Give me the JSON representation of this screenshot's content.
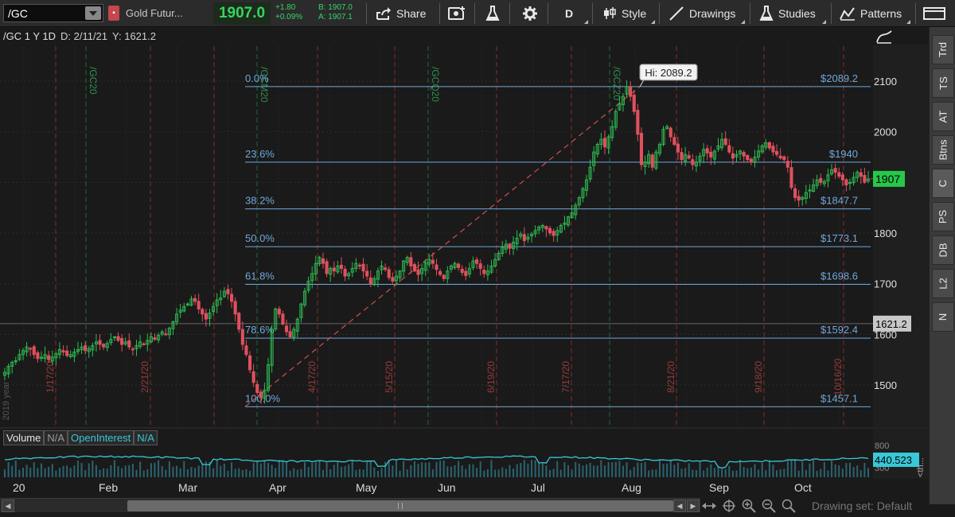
{
  "toolbar": {
    "symbol": "/GC",
    "description": "Gold Futur...",
    "last_price": "1907.0",
    "change": "+1.80",
    "change_pct": "+0.09%",
    "bid": "B: 1907.0",
    "ask": "A: 1907.1",
    "share_label": "Share",
    "period_label": "D",
    "style_label": "Style",
    "drawings_label": "Drawings",
    "studies_label": "Studies",
    "patterns_label": "Patterns",
    "icons": [
      "dropdown-icon",
      "share-icon",
      "screenshot-icon",
      "flask-icon",
      "gear-icon",
      "style-icon",
      "drawings-icon",
      "studies-icon",
      "patterns-icon",
      "layout-icon"
    ]
  },
  "chart_header": {
    "title": "/GC 1 Y 1D",
    "date": "D: 2/11/21",
    "yvalue": "Y: 1621.2"
  },
  "right_tabs": [
    "Trd",
    "TS",
    "AT",
    "Btns",
    "C",
    "PS",
    "DB",
    "L2",
    "N"
  ],
  "price_axis": {
    "ticks": [
      "2100",
      "2000",
      "1900",
      "1800",
      "1700",
      "1600",
      "1500"
    ],
    "current_label": "1907",
    "cursor_label": "1621.2"
  },
  "fib_levels": [
    {
      "pct": "0.0%",
      "price": "$2089.2",
      "value": 2089.2
    },
    {
      "pct": "23.6%",
      "price": "$1940",
      "value": 1940
    },
    {
      "pct": "38.2%",
      "price": "$1847.7",
      "value": 1847.7
    },
    {
      "pct": "50.0%",
      "price": "$1773.1",
      "value": 1773.1
    },
    {
      "pct": "61.8%",
      "price": "$1698.6",
      "value": 1698.6
    },
    {
      "pct": "78.6%",
      "price": "$1592.4",
      "value": 1592.4
    },
    {
      "pct": "100.0%",
      "price": "$1457.1",
      "value": 1457.1
    }
  ],
  "hi_label": "Hi: 2089.2",
  "contract_labels": [
    "/GC20",
    "/GCM20",
    "/GCQ20",
    "/GCZ20"
  ],
  "date_labels": [
    "1/17/20",
    "2/21/20",
    "4/17/20",
    "5/15/20",
    "6/19/20",
    "7/17/20",
    "8/21/20",
    "9/18/20",
    "10/16/20"
  ],
  "year_label": "2019 year",
  "volume_pane": {
    "volume_label": "Volume",
    "volume_value": "N/A",
    "oi_label": "OpenInterest",
    "oi_value": "N/A",
    "axis_top": "800",
    "axis_bottom": "300",
    "oi_current": "440.523",
    "side_label": "<th..."
  },
  "months": [
    "20",
    "Feb",
    "Mar",
    "Apr",
    "May",
    "Jun",
    "Jul",
    "Aug",
    "Sep",
    "Oct"
  ],
  "drawing_set": "Drawing set: Default",
  "colors": {
    "up": "#2ebd52",
    "down": "#e0505e",
    "fib": "#6fa8dc",
    "oi": "#38c8d8",
    "price_tag": "#27c84a"
  },
  "chart_data": {
    "type": "candlestick",
    "ylim": [
      1430,
      2160
    ],
    "closes": [
      1525,
      1537,
      1545,
      1548,
      1560,
      1568,
      1575,
      1572,
      1560,
      1552,
      1555,
      1560,
      1550,
      1555,
      1562,
      1570,
      1565,
      1558,
      1560,
      1565,
      1570,
      1575,
      1568,
      1572,
      1578,
      1585,
      1580,
      1575,
      1582,
      1590,
      1595,
      1588,
      1580,
      1585,
      1575,
      1570,
      1578,
      1585,
      1580,
      1588,
      1595,
      1590,
      1598,
      1605,
      1600,
      1612,
      1625,
      1640,
      1648,
      1655,
      1660,
      1670,
      1665,
      1650,
      1640,
      1630,
      1642,
      1655,
      1668,
      1672,
      1685,
      1680,
      1665,
      1640,
      1610,
      1580,
      1560,
      1530,
      1505,
      1485,
      1475,
      1490,
      1540,
      1610,
      1650,
      1640,
      1620,
      1605,
      1595,
      1610,
      1630,
      1660,
      1685,
      1705,
      1720,
      1740,
      1752,
      1740,
      1720,
      1730,
      1725,
      1735,
      1730,
      1715,
      1720,
      1730,
      1740,
      1735,
      1725,
      1715,
      1700,
      1710,
      1725,
      1735,
      1728,
      1712,
      1705,
      1715,
      1725,
      1745,
      1752,
      1735,
      1725,
      1718,
      1730,
      1742,
      1748,
      1740,
      1728,
      1718,
      1710,
      1725,
      1735,
      1740,
      1732,
      1722,
      1716,
      1730,
      1745,
      1740,
      1730,
      1720,
      1725,
      1735,
      1748,
      1760,
      1772,
      1778,
      1770,
      1782,
      1790,
      1798,
      1785,
      1792,
      1798,
      1805,
      1812,
      1815,
      1808,
      1800,
      1795,
      1805,
      1815,
      1820,
      1832,
      1840,
      1855,
      1870,
      1888,
      1905,
      1930,
      1960,
      1975,
      1985,
      1970,
      1990,
      2010,
      2040,
      2055,
      2070,
      2089,
      2070,
      2040,
      1995,
      1935,
      1940,
      1955,
      1930,
      1960,
      1975,
      2005,
      2010,
      1990,
      1975,
      1960,
      1945,
      1955,
      1948,
      1935,
      1940,
      1952,
      1965,
      1958,
      1950,
      1962,
      1972,
      1985,
      1975,
      1960,
      1948,
      1955,
      1962,
      1952,
      1945,
      1940,
      1950,
      1962,
      1972,
      1978,
      1968,
      1960,
      1955,
      1948,
      1945,
      1930,
      1890,
      1870,
      1865,
      1870,
      1880,
      1885,
      1895,
      1905,
      1900,
      1902,
      1915,
      1925,
      1920,
      1912,
      1905,
      1895,
      1900,
      1910,
      1920,
      1912,
      1900,
      1907
    ]
  }
}
